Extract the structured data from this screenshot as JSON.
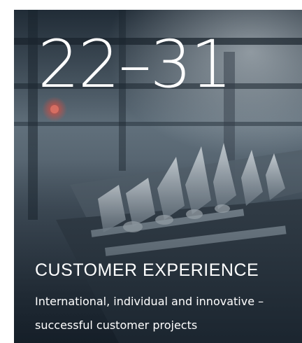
{
  "teaser": {
    "page_range": "22–31",
    "title": "CUSTOMER EXPERIENCE",
    "description": "International, individual and innovative – successful customer projects"
  },
  "colors": {
    "text": "#ffffff",
    "image_tone": "#3a4650"
  }
}
